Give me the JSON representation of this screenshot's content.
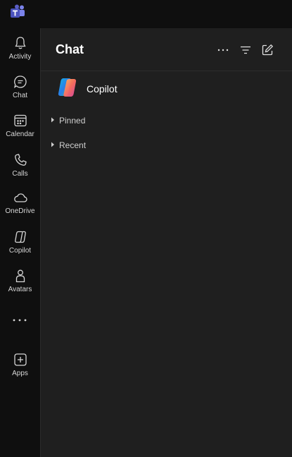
{
  "nav": {
    "items": [
      {
        "id": "activity",
        "label": "Activity",
        "icon": "bell-icon"
      },
      {
        "id": "chat",
        "label": "Chat",
        "icon": "chat-bubble-icon"
      },
      {
        "id": "calendar",
        "label": "Calendar",
        "icon": "calendar-icon"
      },
      {
        "id": "calls",
        "label": "Calls",
        "icon": "phone-icon"
      },
      {
        "id": "onedrive",
        "label": "OneDrive",
        "icon": "cloud-icon"
      },
      {
        "id": "copilot",
        "label": "Copilot",
        "icon": "copilot-icon"
      },
      {
        "id": "avatars",
        "label": "Avatars",
        "icon": "person-icon"
      },
      {
        "id": "apps",
        "label": "Apps",
        "icon": "plus-square-icon"
      }
    ],
    "more_icon": "more-horizontal-icon"
  },
  "chat_panel": {
    "title": "Chat",
    "actions": [
      "more-options-icon",
      "filter-icon",
      "new-chat-icon"
    ],
    "copilot_label": "Copilot",
    "sections": [
      {
        "label": "Pinned",
        "expanded": false
      },
      {
        "label": "Recent",
        "expanded": false
      }
    ]
  },
  "colors": {
    "background": "#0f0f0f",
    "panel": "#1f1f1f",
    "accent": "#5b5fc7"
  }
}
